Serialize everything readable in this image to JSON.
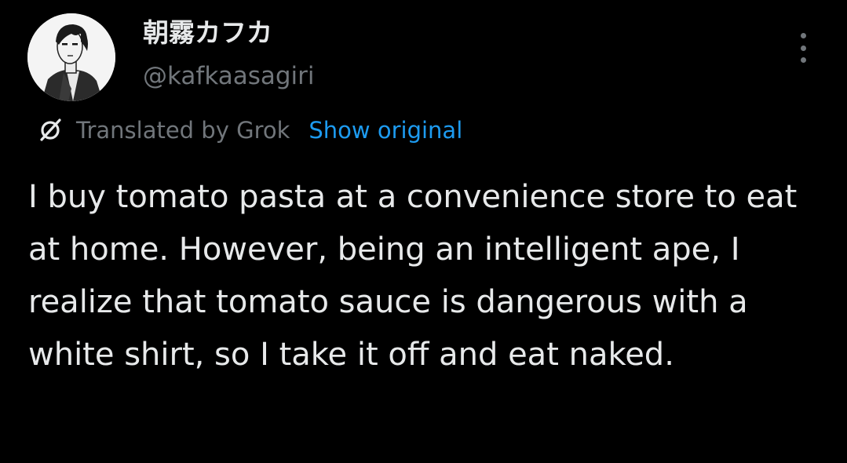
{
  "author": {
    "display_name": "朝霧カフカ",
    "handle": "@kafkaasagiri"
  },
  "translation": {
    "label": "Translated by Grok",
    "show_original_label": "Show original"
  },
  "tweet": {
    "text": "I buy tomato pasta at a convenience store to eat at home. However, being an intelligent ape, I realize that tomato sauce is dangerous with a white shirt, so I take it off and eat naked."
  },
  "icons": {
    "more": "more-vertical-icon",
    "translate": "grok-icon"
  },
  "colors": {
    "background": "#000000",
    "primary_text": "#e7e9ea",
    "secondary_text": "#71767b",
    "link": "#1d9bf0"
  }
}
